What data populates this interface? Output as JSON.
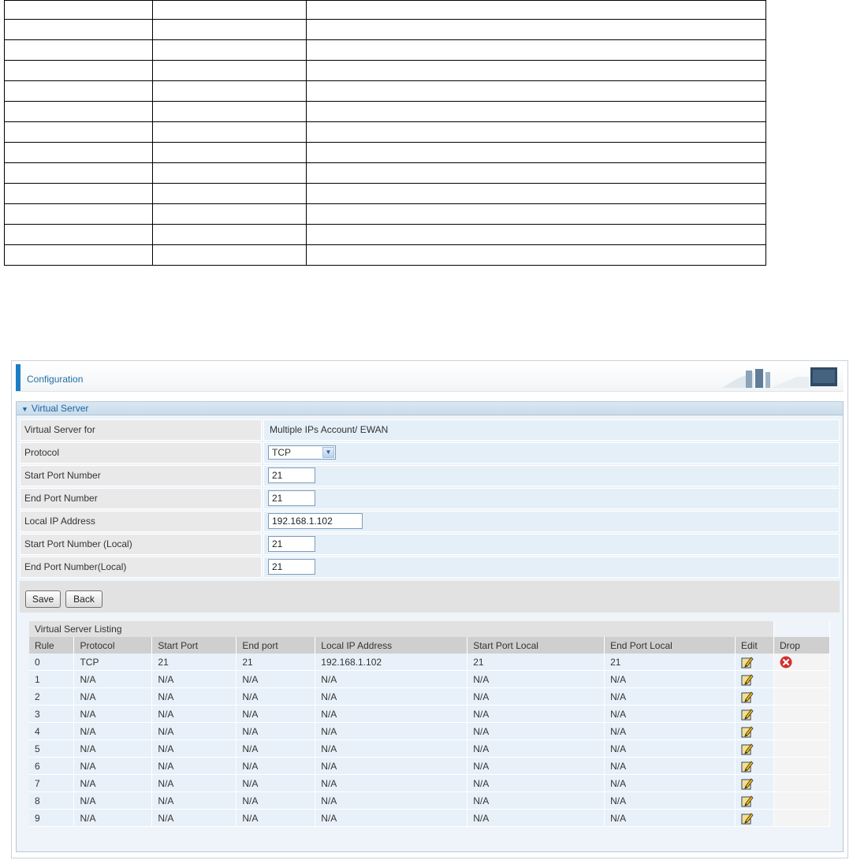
{
  "config": {
    "title": "Configuration",
    "section_title": "Virtual Server",
    "fields": {
      "virtual_server_for_label": "Virtual Server for",
      "virtual_server_for_value": "Multiple IPs Account/ EWAN",
      "protocol_label": "Protocol",
      "protocol_value": "TCP",
      "start_port_label": "Start Port Number",
      "start_port_value": "21",
      "end_port_label": "End Port Number",
      "end_port_value": "21",
      "local_ip_label": "Local IP Address",
      "local_ip_value": "192.168.1.102",
      "start_port_local_label": "Start Port Number (Local)",
      "start_port_local_value": "21",
      "end_port_local_label": "End Port Number(Local)",
      "end_port_local_value": "21"
    },
    "buttons": {
      "save": "Save",
      "back": "Back"
    },
    "listing": {
      "caption": "Virtual Server Listing",
      "headers": [
        "Rule",
        "Protocol",
        "Start Port",
        "End port",
        "Local IP Address",
        "Start Port Local",
        "End Port Local",
        "Edit",
        "Drop"
      ],
      "rows": [
        [
          "0",
          "TCP",
          "21",
          "21",
          "192.168.1.102",
          "21",
          "21"
        ],
        [
          "1",
          "N/A",
          "N/A",
          "N/A",
          "N/A",
          "N/A",
          "N/A"
        ],
        [
          "2",
          "N/A",
          "N/A",
          "N/A",
          "N/A",
          "N/A",
          "N/A"
        ],
        [
          "3",
          "N/A",
          "N/A",
          "N/A",
          "N/A",
          "N/A",
          "N/A"
        ],
        [
          "4",
          "N/A",
          "N/A",
          "N/A",
          "N/A",
          "N/A",
          "N/A"
        ],
        [
          "5",
          "N/A",
          "N/A",
          "N/A",
          "N/A",
          "N/A",
          "N/A"
        ],
        [
          "6",
          "N/A",
          "N/A",
          "N/A",
          "N/A",
          "N/A",
          "N/A"
        ],
        [
          "7",
          "N/A",
          "N/A",
          "N/A",
          "N/A",
          "N/A",
          "N/A"
        ],
        [
          "8",
          "N/A",
          "N/A",
          "N/A",
          "N/A",
          "N/A",
          "N/A"
        ],
        [
          "9",
          "N/A",
          "N/A",
          "N/A",
          "N/A",
          "N/A",
          "N/A"
        ]
      ],
      "icons": {
        "edit": "edit-pencil-icon",
        "drop": "drop-delete-icon"
      }
    },
    "colors": {
      "accent": "#1a7fc4",
      "drop_red": "#d32f2f"
    }
  }
}
